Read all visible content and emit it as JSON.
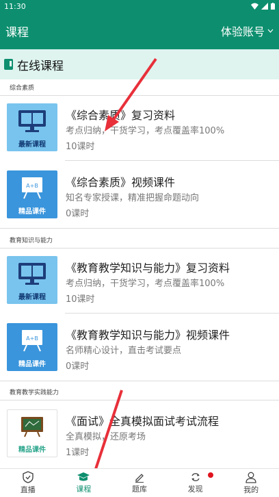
{
  "status": {
    "time": "11:30"
  },
  "header": {
    "title": "课程",
    "account": "体验账号"
  },
  "online": {
    "label": "在线课程"
  },
  "sections": [
    {
      "name": "综合素质"
    },
    {
      "name": "教育知识与能力"
    },
    {
      "name": "教育教学实践能力"
    }
  ],
  "courses": [
    {
      "thumb": "最新课程",
      "title": "《综合素质》复习资料",
      "desc": "考点归纳，干货学习，考点覆盖率100%",
      "count": "10课时"
    },
    {
      "thumb": "精品课件",
      "thumb_text": "A+B",
      "title": "《综合素质》视频课件",
      "desc": "知名专家授课，精准把握命题动向",
      "count": "0课时"
    },
    {
      "thumb": "最新课程",
      "title": "《教育教学知识与能力》复习资料",
      "desc": "考点归纳，干货学习，考点覆盖率100%",
      "count": "10课时"
    },
    {
      "thumb": "精品课件",
      "thumb_text": "A+B",
      "title": "《教育教学知识与能力》视频课件",
      "desc": "名师精心设计，直击考试要点",
      "count": "0课时"
    },
    {
      "thumb": "精品课件",
      "title": "《面试》全真模拟面试考试流程",
      "desc": "全真模拟，还原考场",
      "count": "1课时"
    }
  ],
  "nav": [
    {
      "label": "直播",
      "icon": "shield-icon"
    },
    {
      "label": "课程",
      "icon": "graduation-cap-icon",
      "active": true
    },
    {
      "label": "题库",
      "icon": "pencil-icon"
    },
    {
      "label": "发现",
      "icon": "refresh-icon",
      "badge": true
    },
    {
      "label": "我的",
      "icon": "user-icon"
    }
  ],
  "colors": {
    "primary": "#0d8f6f",
    "highlight": "#dff4ef",
    "badge": "#e0141e",
    "arrow": "#e8303a"
  }
}
